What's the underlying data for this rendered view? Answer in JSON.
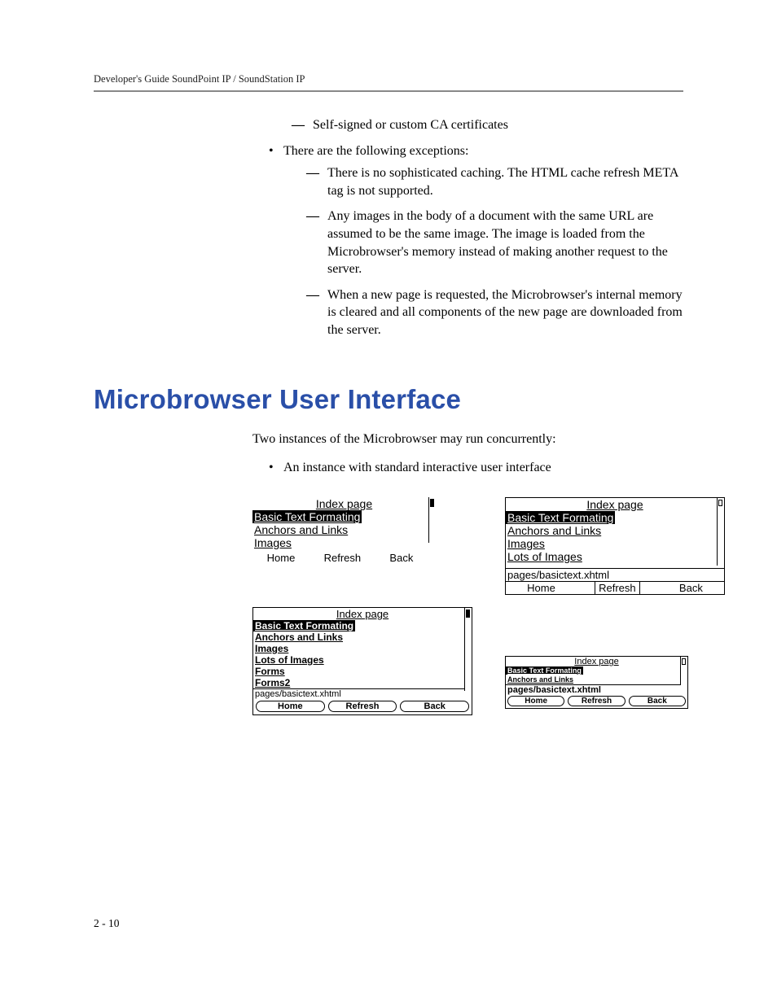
{
  "header": {
    "running": "Developer's Guide SoundPoint IP / SoundStation IP"
  },
  "body": {
    "dash1": "Self-signed or custom CA certificates",
    "bullet1": "There are the following exceptions:",
    "dash2": "There is no sophisticated caching. The HTML cache refresh META tag is not supported.",
    "dash3": "Any images in the body of a document with the same URL are assumed to be the same image. The image is loaded from the Microbrowser's memory instead of making another request to the server.",
    "dash4": "When a new page is requested, the Microbrowser's internal memory is cleared and all components of the new page are downloaded from the server."
  },
  "section": {
    "title": "Microbrowser User Interface"
  },
  "intro": {
    "p1": "Two instances of the Microbrowser may run concurrently:",
    "b1": "An instance with standard interactive user interface"
  },
  "shots": {
    "title": "Index page",
    "sel": "Basic Text Formating",
    "l1": "Anchors and Links",
    "l2": "Images",
    "l3": "Lots of Images",
    "l4": "Forms",
    "l5": "Forms2",
    "status": "pages/basictext.xhtml",
    "home": "Home",
    "refresh": "Refresh",
    "back": "Back"
  },
  "footer": {
    "pagenum": "2 - 10"
  }
}
